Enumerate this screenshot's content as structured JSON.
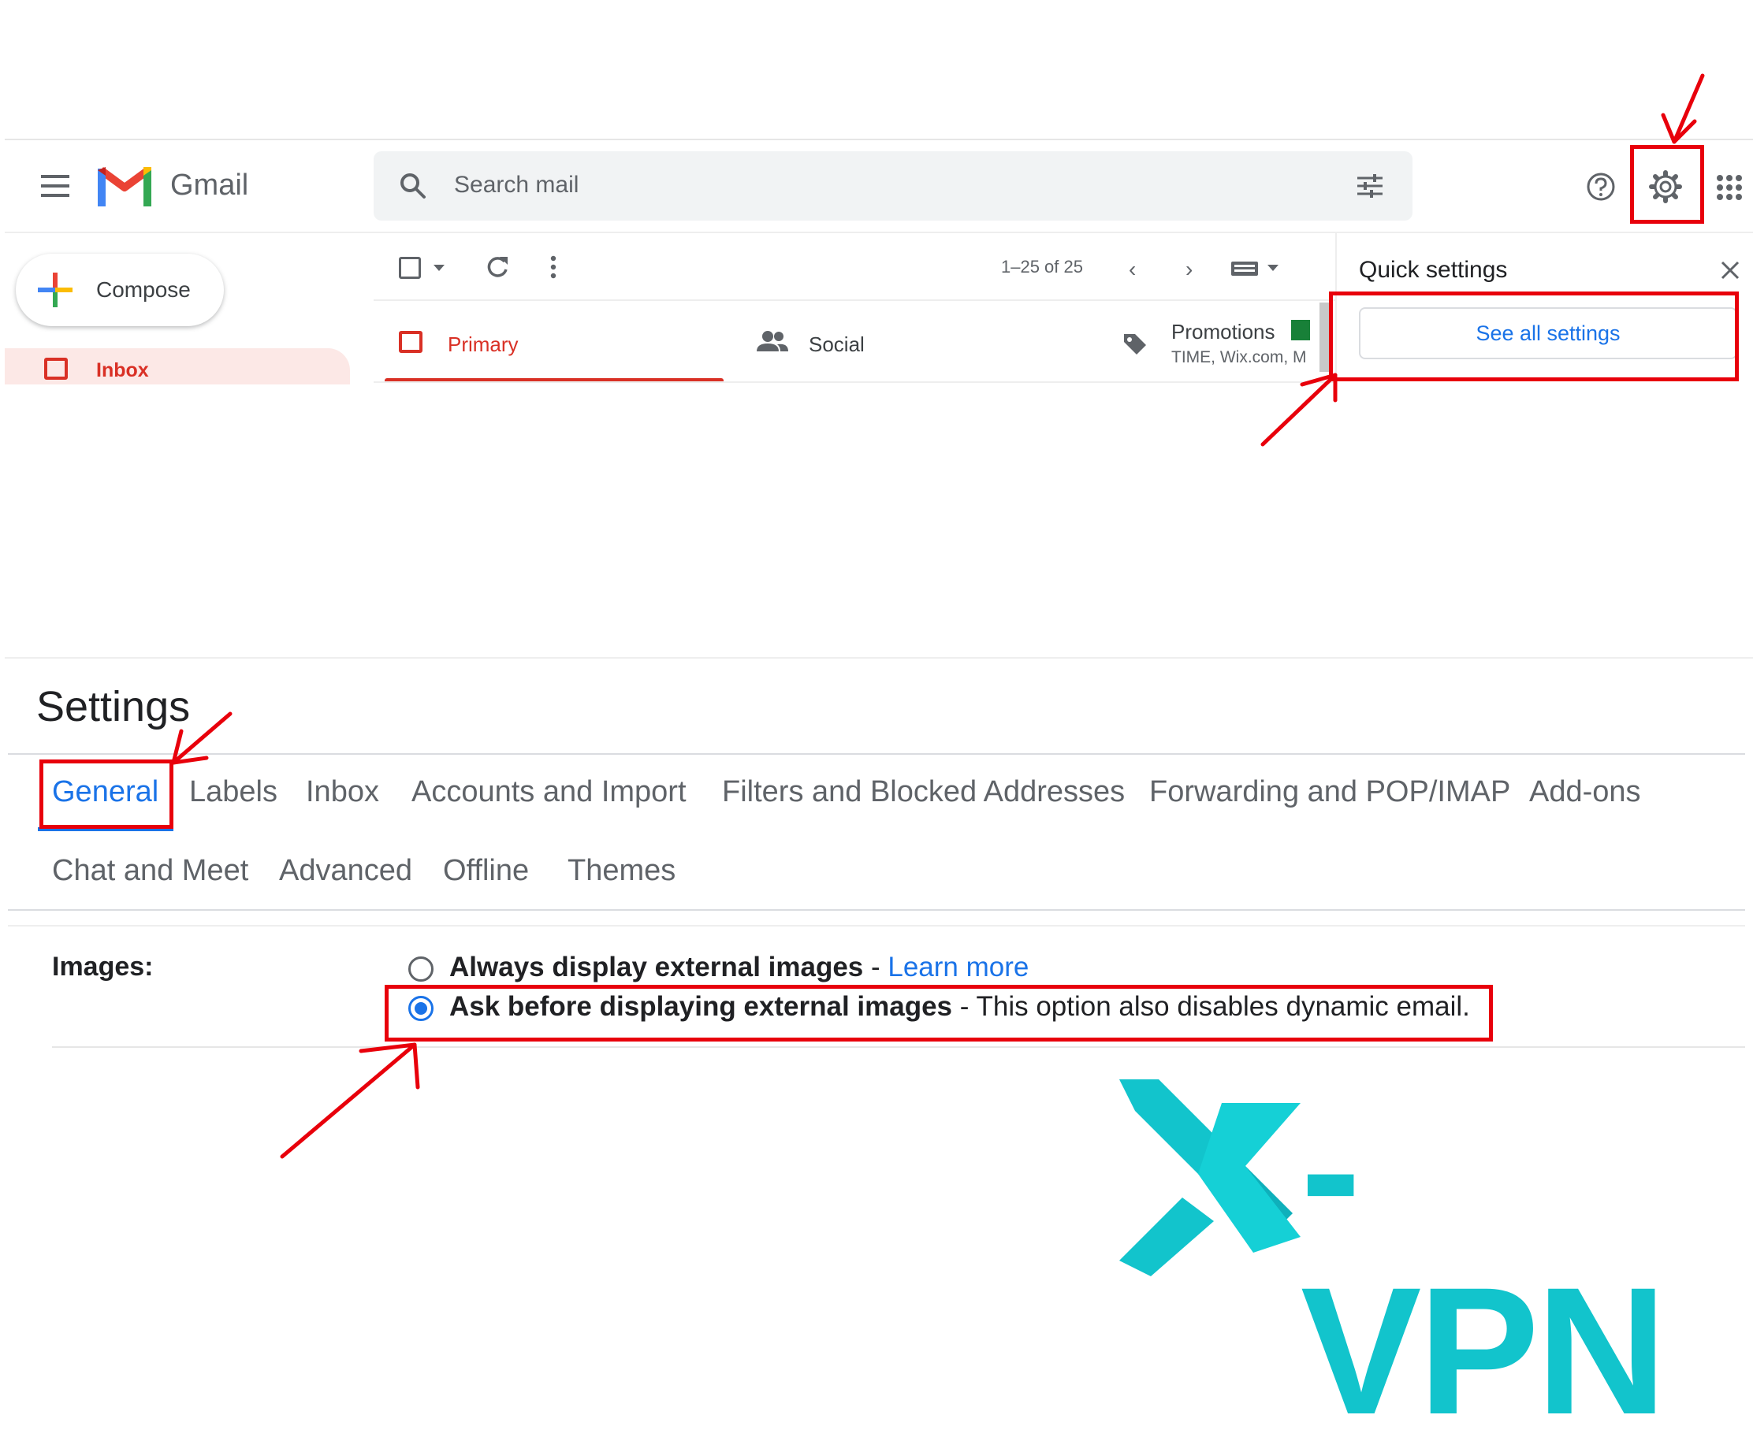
{
  "header": {
    "app_name": "Gmail",
    "search_placeholder": "Search mail"
  },
  "sidebar": {
    "compose_label": "Compose",
    "items": [
      {
        "label": "Inbox"
      }
    ]
  },
  "toolbar": {
    "pagination": "1–25 of 25"
  },
  "category_tabs": [
    {
      "label": "Primary"
    },
    {
      "label": "Social"
    },
    {
      "label": "Promotions",
      "subtitle": "TIME, Wix.com, M"
    }
  ],
  "quick_settings": {
    "title": "Quick settings",
    "see_all_label": "See all settings"
  },
  "settings": {
    "title": "Settings",
    "tabs_row1": [
      "General",
      "Labels",
      "Inbox",
      "Accounts and Import",
      "Filters and Blocked Addresses",
      "Forwarding and POP/IMAP",
      "Add-ons"
    ],
    "tabs_row2": [
      "Chat and Meet",
      "Advanced",
      "Offline",
      "Themes"
    ],
    "images_label": "Images:",
    "option_always": "Always display external images",
    "option_always_sep": " - ",
    "learn_more": "Learn more",
    "option_ask": "Ask before displaying external images",
    "option_ask_desc": " - This option also disables dynamic email.",
    "selected_option": "ask"
  },
  "watermark": {
    "brand": "X-VPN",
    "text": "-VPN"
  },
  "colors": {
    "accent_blue": "#1a73e8",
    "primary_red": "#d93025",
    "annotation_red": "#e8000b",
    "brand_teal": "#12c4cc",
    "promo_green": "#188038"
  }
}
